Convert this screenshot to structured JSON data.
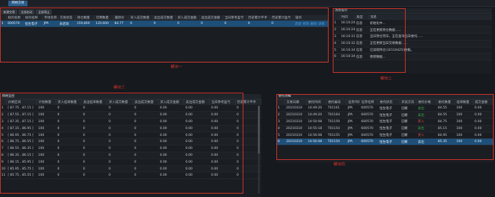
{
  "topbar": {
    "tab": "网格交易"
  },
  "module1": {
    "buttons": [
      "新建交易",
      "全部启动",
      "全部停止"
    ],
    "headers": [
      "",
      "标的名称",
      "标的名称",
      "市场名称",
      "交易状态",
      "持仓数量",
      "可用数量",
      "最新价",
      "买入成交数量",
      "卖出成交数量",
      "买入成交金额",
      "卖出成交金额",
      "当日参考盈亏",
      "历史累计平手",
      "历史累计盈亏",
      "操作"
    ],
    "row": [
      "1",
      "600570",
      "恒生电子",
      "JPA",
      "未启动",
      "159,800",
      "120,600",
      "84.77",
      "0",
      "0",
      "0",
      "0",
      "0",
      "0",
      "0"
    ],
    "actions": [
      "启动",
      "修改",
      "删除",
      "详情"
    ],
    "label": "模块一"
  },
  "module2": {
    "title": "消息提示",
    "headers": [
      "",
      "时间",
      "类型",
      "消息"
    ],
    "rows": [
      {
        "i": "1",
        "time": "16:10:24",
        "type": "信息",
        "msg": "初始化中..."
      },
      {
        "i": "2",
        "time": "16:10:24",
        "type": "信息",
        "msg": "正在更新持仓数据......"
      },
      {
        "i": "3",
        "time": "16:10:31",
        "type": "信息",
        "msg": "当日持仓完毕，正在查询当日委托......"
      },
      {
        "i": "4",
        "time": "16:10:32",
        "type": "信息",
        "msg": "正在更新当日交易数据......"
      },
      {
        "i": "5",
        "time": "16:10:34",
        "type": "信息",
        "msg": "已读取持仓(10110425)数据。"
      },
      {
        "i": "6",
        "time": "16:10:34",
        "type": "信息",
        "msg": "更新数据..."
      }
    ],
    "label": "模块二"
  },
  "module3": {
    "title": "网格监控",
    "label_top": "模块三",
    "headers": [
      "",
      "价格区间",
      "计划数量",
      "买入挂单数量",
      "卖出挂单数量",
      "买入成交数量",
      "卖出成交数量",
      "买入成交金额",
      "卖出成交金额",
      "当日参考盈亏",
      "历史累计平手"
    ],
    "rows": [
      [
        "1",
        "[ 87.75 , 87.15 ]",
        "100",
        "0",
        "0",
        "0",
        "0",
        "0.00",
        "0.00",
        "0.00",
        "0"
      ],
      [
        "2",
        "[ 87.55 , 87.15 ]",
        "100",
        "0",
        "0",
        "0",
        "0",
        "0.00",
        "0.00",
        "0.00",
        "0"
      ],
      [
        "3",
        "[ 87.35 , 87.15 ]",
        "100",
        "0",
        "0",
        "0",
        "0",
        "0.00",
        "0.00",
        "0.00",
        "0"
      ],
      [
        "4",
        "[ 87.15 , 86.95 ]",
        "100",
        "0",
        "0",
        "0",
        "0",
        "0.00",
        "0.00",
        "0.00",
        "0"
      ],
      [
        "5",
        "[ 86.95 , 86.75 ]",
        "100",
        "0",
        "0",
        "0",
        "0",
        "0.00",
        "0.00",
        "0.00",
        "0"
      ],
      [
        "6",
        "[ 86.75 , 86.55 ]",
        "100",
        "0",
        "0",
        "0",
        "0",
        "0.00",
        "0.00",
        "0.00",
        "0"
      ],
      [
        "7",
        "[ 86.55 , 86.35 ]",
        "100",
        "0",
        "0",
        "0",
        "0",
        "0.00",
        "0.00",
        "0.00",
        "0"
      ],
      [
        "8",
        "[ 86.35 , 86.15 ]",
        "100",
        "0",
        "0",
        "0",
        "0",
        "0.00",
        "0.00",
        "0.00",
        "0"
      ],
      [
        "9",
        "[ 86.15 , 85.95 ]",
        "100",
        "0",
        "0",
        "0",
        "0",
        "0.00",
        "0.00",
        "0.00",
        "0"
      ],
      [
        "10",
        "[ 85.95 , 85.75 ]",
        "100",
        "0",
        "0",
        "0",
        "0",
        "0.00",
        "0.00",
        "0.00",
        "0"
      ],
      [
        "11",
        "[ 85.75 , 85.55 ]",
        "100",
        "0",
        "0",
        "0",
        "0",
        "0.00",
        "0.00",
        "0.00",
        "0"
      ]
    ]
  },
  "module4": {
    "title": "委托明细",
    "label": "模块四",
    "headers": [
      "",
      "交易日期",
      "委托时间",
      "委托编号",
      "证券代码",
      "证券名称",
      "委托状态",
      "买卖方向",
      "委托价格",
      "委托数量",
      "挂单数量",
      "成交金额"
    ],
    "rows": [
      [
        "1",
        "20210310",
        "14:49:20",
        "T01161",
        "JPA",
        "600570",
        "恒生电子",
        "已撤",
        "卖出",
        "84.55",
        "100",
        "0.00"
      ],
      [
        "2",
        "20210310",
        "14:49:20",
        "T01164",
        "JPA",
        "600570",
        "恒生电子",
        "已撤",
        "卖出",
        "84.55",
        "100",
        "0.00"
      ],
      [
        "3",
        "20210310",
        "14:50:08",
        "T01159",
        "JPA",
        "600570",
        "恒生电子",
        "已撤",
        "买入",
        "84.75",
        "100",
        "0.00"
      ],
      [
        "4",
        "20210310",
        "14:55:18",
        "T01154",
        "JPA",
        "600570",
        "恒生电子",
        "已撤",
        "卖出",
        "85.15",
        "100",
        "0.00"
      ],
      [
        "5",
        "20210310",
        "14:56:08",
        "T01155",
        "JPA",
        "600570",
        "恒生电子",
        "已撤",
        "买入",
        "84.95",
        "100",
        "0.00"
      ],
      [
        "6",
        "20210310",
        "14:56:08",
        "T01154",
        "JPA",
        "600570",
        "恒生电子",
        "已撤",
        "卖出",
        "85.35",
        "100",
        "0.00"
      ]
    ],
    "selected_row": 5
  },
  "colors": {
    "annotation": "#d8342c",
    "selection": "#1d4f78",
    "buy": "#e84a3a",
    "sell": "#37b34a",
    "tab": "#2b5d8a"
  }
}
